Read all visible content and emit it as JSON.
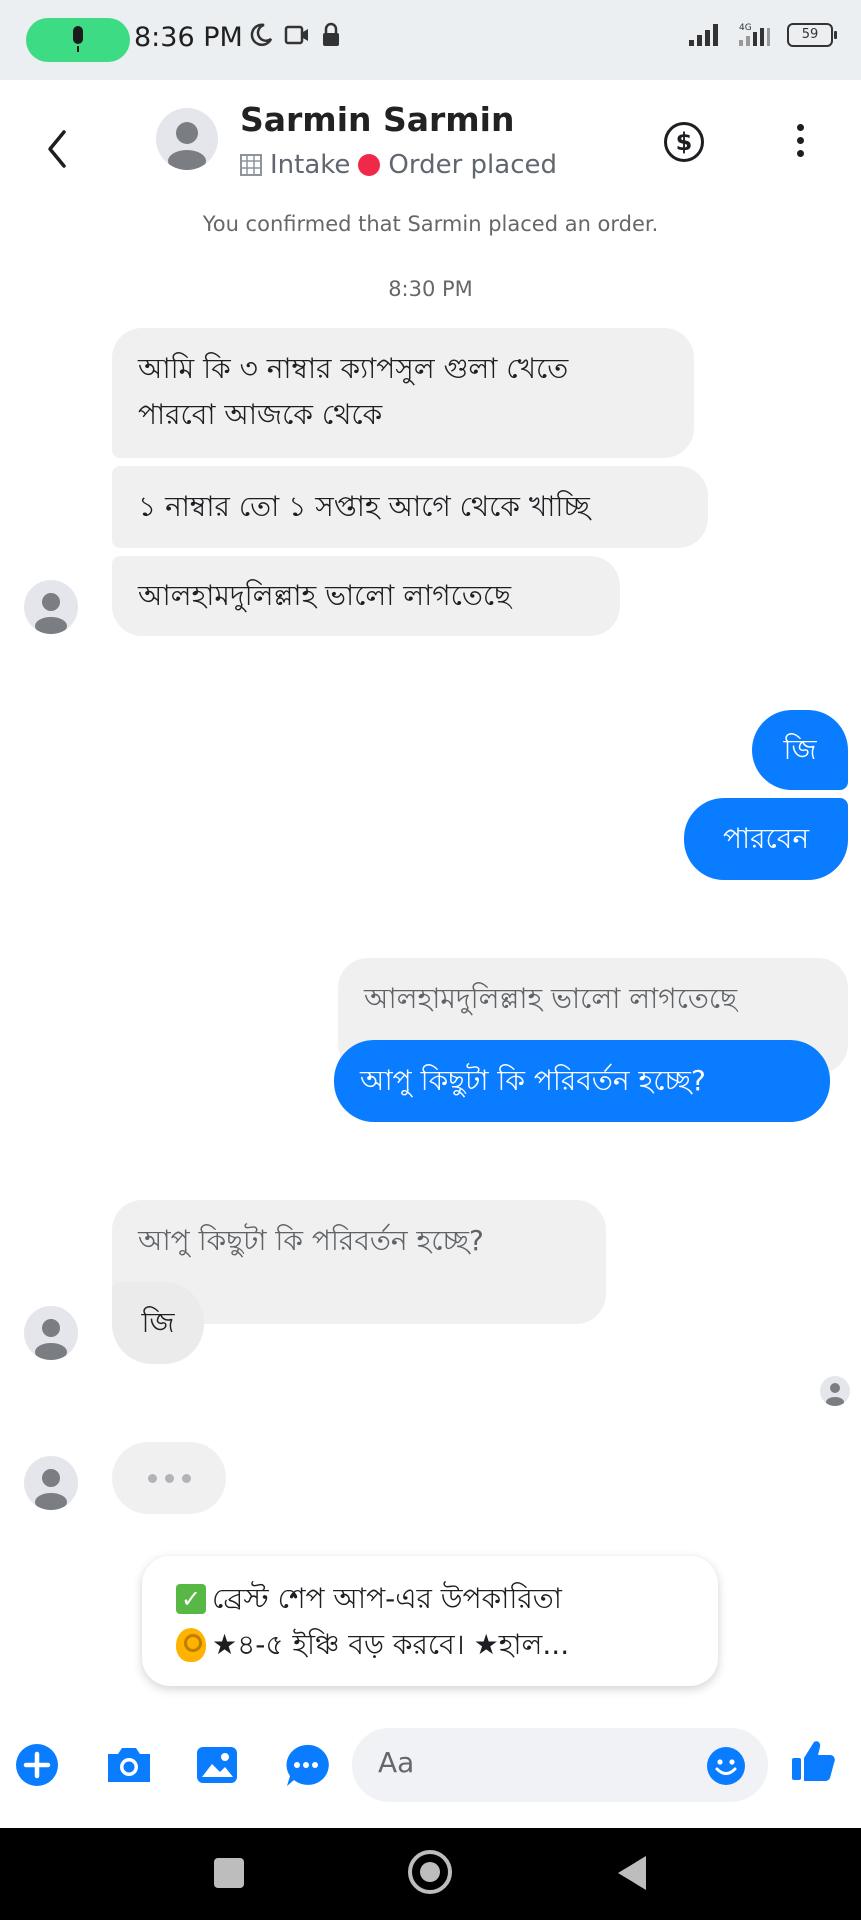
{
  "status_bar": {
    "time": "8:36 PM",
    "battery": "59",
    "network": "4G",
    "icons": [
      "mic-icon",
      "moon-icon",
      "screen-record-icon",
      "lock-icon",
      "signal-icon",
      "battery-icon"
    ]
  },
  "header": {
    "name": "Sarmin Sarmin",
    "stage": "Intake",
    "order_status": "Order placed",
    "confirmation": "You confirmed that Sarmin placed an order."
  },
  "conversation": {
    "timestamp": "8:30 PM",
    "incoming_1": "আমি কি ৩ নাম্বার ক্যাপসুল গুলা খেতে",
    "incoming_1_cont": "পারবো আজকে থেকে",
    "incoming_2": "১ নাম্বার তো ১ সপ্তাহ আগে থেকে খাচ্ছি",
    "incoming_3": "আলহামদুলিল্লাহ ভালো লাগতেছে",
    "outgoing_1": "জি",
    "outgoing_2": "পারবেন",
    "reply_quote_1": "আলহামদুলিল্লাহ ভালো লাগতেছে",
    "outgoing_3": "আপু কিছুটা কি পরিবর্তন হচ্ছে?",
    "reply_quote_2": "আপু কিছুটা কি পরিবর্তন হচ্ছে?",
    "incoming_4": "জি"
  },
  "suggestion": {
    "line1": "ব্রেস্ট শেপ আপ-এর উপকারিতা",
    "line2": "★৪-৫ ইঞ্চি বড় করবে। ★হাল..."
  },
  "composer": {
    "placeholder": "Aa"
  },
  "colors": {
    "accent": "#0a7cff",
    "incoming_bubble": "#f0f0f0",
    "order_dot": "#f02849",
    "mic_pill": "#3ddc84"
  }
}
